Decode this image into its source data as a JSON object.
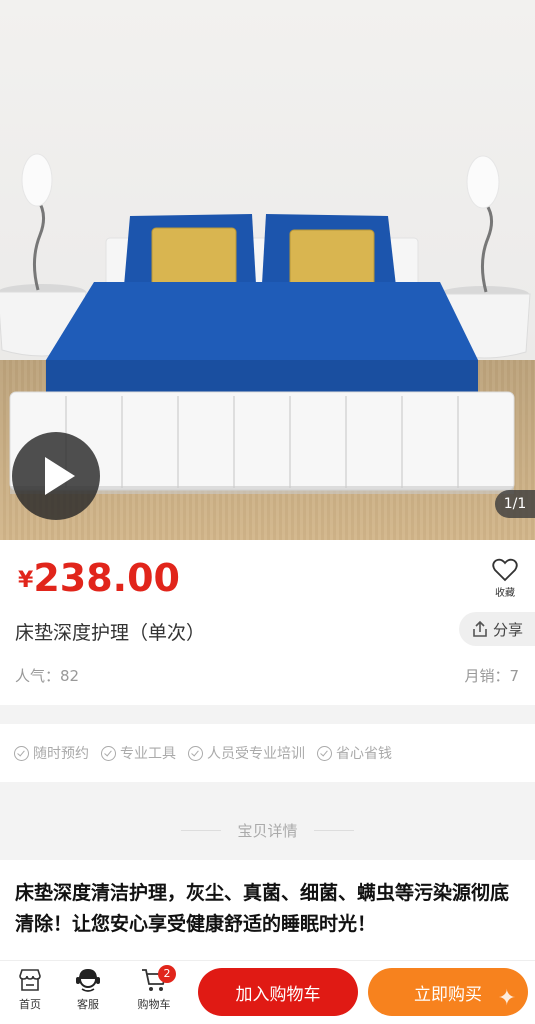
{
  "product": {
    "currency": "¥",
    "price": "238.00",
    "title": "床垫深度护理（单次）",
    "popularity": "人气：82",
    "monthly_sales": "月销：7",
    "image_counter": "1/1",
    "favorite_label": "收藏",
    "share_label": "分享"
  },
  "guarantees": [
    "随时预约",
    "专业工具",
    "人员受专业培训",
    "省心省钱"
  ],
  "detail": {
    "heading": "宝贝详情",
    "description": "床垫深度清洁护理，灰尘、真菌、细菌、螨虫等污染源彻底清除！让您安心享受健康舒适的睡眠时光！"
  },
  "bottom_bar": {
    "home_label": "首页",
    "service_label": "客服",
    "cart_label": "购物车",
    "cart_count": "2",
    "add_to_cart": "加入购物车",
    "buy_now": "立即购买"
  },
  "colors": {
    "price_red": "#e1251b",
    "cart_button": "#e01a14",
    "buy_button": "#f7821e",
    "bedding_blue": "#1f5cb8",
    "pillow_gold": "#d9b550"
  },
  "icons": [
    "play-icon",
    "heart-icon",
    "share-icon",
    "check-icon",
    "home-store-icon",
    "customer-service-icon",
    "cart-icon",
    "sparkle-icon"
  ]
}
